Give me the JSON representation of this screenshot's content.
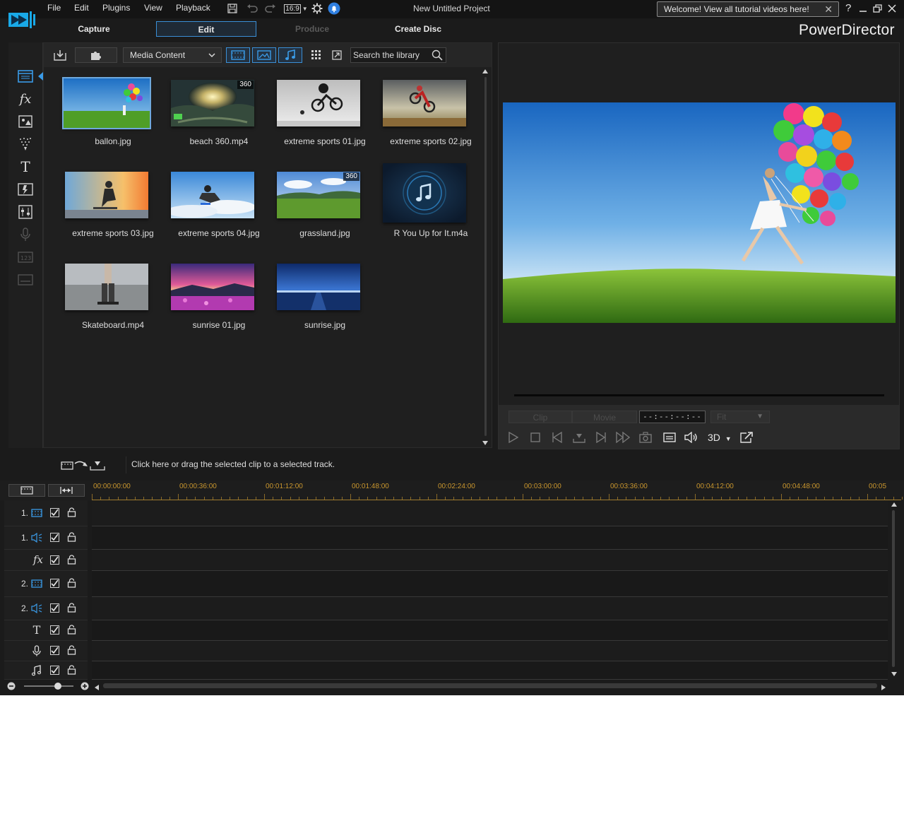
{
  "titlebar": {
    "menus": [
      "File",
      "Edit",
      "Plugins",
      "View",
      "Playback"
    ],
    "aspect_ratio": "16:9",
    "project_title": "New Untitled Project",
    "welcome_banner": "Welcome! View all tutorial videos here!",
    "help_label": "?"
  },
  "modes": {
    "capture": "Capture",
    "edit": "Edit",
    "produce": "Produce",
    "create_disc": "Create Disc",
    "active": "edit"
  },
  "brand": "PowerDirector",
  "library": {
    "media_filter": "Media Content",
    "search_placeholder": "Search the library",
    "items": [
      {
        "label": "ballon.jpg",
        "selected": true,
        "badge": ""
      },
      {
        "label": "beach 360.mp4",
        "selected": false,
        "badge": "360"
      },
      {
        "label": "extreme sports 01.jpg",
        "selected": false,
        "badge": ""
      },
      {
        "label": "extreme sports 02.jpg",
        "selected": false,
        "badge": ""
      },
      {
        "label": "extreme sports 03.jpg",
        "selected": false,
        "badge": ""
      },
      {
        "label": "extreme sports 04.jpg",
        "selected": false,
        "badge": ""
      },
      {
        "label": "grassland.jpg",
        "selected": false,
        "badge": "360"
      },
      {
        "label": "R You Up for It.m4a",
        "selected": false,
        "badge": ""
      },
      {
        "label": "Skateboard.mp4",
        "selected": false,
        "badge": ""
      },
      {
        "label": "sunrise 01.jpg",
        "selected": false,
        "badge": ""
      },
      {
        "label": "sunrise.jpg",
        "selected": false,
        "badge": ""
      }
    ]
  },
  "preview": {
    "tab_clip": "Clip",
    "tab_movie": "Movie",
    "timecode": "--:--:--:--",
    "fit": "Fit",
    "threeD": "3D"
  },
  "timeline": {
    "message": "Click here or drag the selected clip to a selected track.",
    "ruler": [
      "00:00:00:00",
      "00:00:36:00",
      "00:01:12:00",
      "00:01:48:00",
      "00:02:24:00",
      "00:03:00:00",
      "00:03:36:00",
      "00:04:12:00",
      "00:04:48:00",
      "00:05"
    ],
    "tracks": [
      {
        "num": "1.",
        "type": "video"
      },
      {
        "num": "1.",
        "type": "audio"
      },
      {
        "num": "",
        "type": "fx"
      },
      {
        "num": "2.",
        "type": "video"
      },
      {
        "num": "2.",
        "type": "audio"
      },
      {
        "num": "",
        "type": "title"
      },
      {
        "num": "",
        "type": "voice"
      },
      {
        "num": "",
        "type": "music"
      }
    ]
  },
  "colors": {
    "accent": "#3a8fd6",
    "ruler_text": "#c9962e",
    "background": "#1b1b1b"
  }
}
